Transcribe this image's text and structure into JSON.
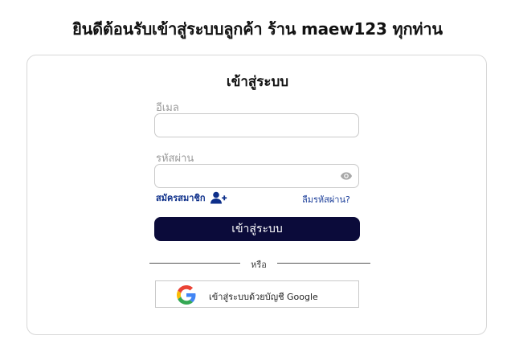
{
  "header": {
    "welcome_text": "ยินดีต้อนรับเข้าสู่ระบบลูกค้า ร้าน maew123 ทุกท่าน"
  },
  "login_card": {
    "title": "เข้าสู่ระบบ",
    "email": {
      "label": "อีเมล",
      "value": "",
      "placeholder": ""
    },
    "password": {
      "label": "รหัสผ่าน",
      "value": "",
      "placeholder": "",
      "toggle_icon": "eye-icon"
    },
    "signup": {
      "label": "สมัครสมาชิก",
      "icon": "add-user-icon"
    },
    "forgot_password": "ลืมรหัสผ่าน?",
    "login_button": "เข้าสู่ระบบ",
    "divider": "หรือ",
    "google_button": {
      "label": "เข้าสู่ระบบด้วยบัญชี Google",
      "icon": "google-icon"
    }
  },
  "colors": {
    "primary_button": "#0b0b3a",
    "link": "#0d2f8a",
    "border": "#c9c9c9"
  }
}
